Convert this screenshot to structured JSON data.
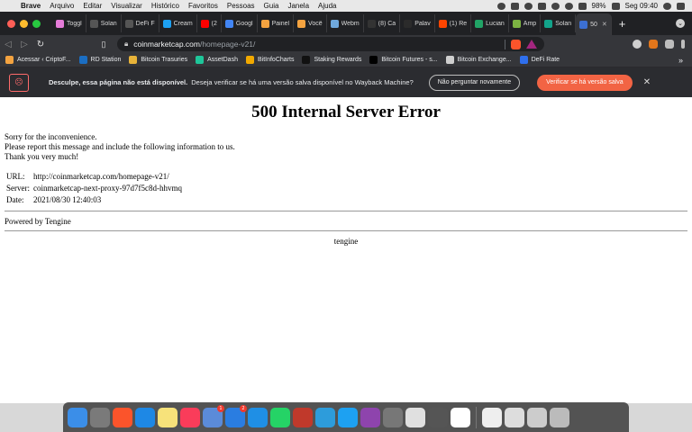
{
  "menubar": {
    "apple_glyph": "",
    "items": [
      "Brave",
      "Arquivo",
      "Editar",
      "Visualizar",
      "Histórico",
      "Favoritos",
      "Pessoas",
      "Guia",
      "Janela",
      "Ajuda"
    ],
    "battery": "98%",
    "clock": "Seg 09:40"
  },
  "tabs": [
    {
      "label": "Toggl",
      "color": "#e57cd8"
    },
    {
      "label": "Solan",
      "color": "#555555"
    },
    {
      "label": "DeFi F",
      "color": "#555555"
    },
    {
      "label": "Cream",
      "color": "#1da1f2"
    },
    {
      "label": "(2",
      "color": "#ff0000"
    },
    {
      "label": "Googl",
      "color": "#4285f4"
    },
    {
      "label": "Painel",
      "color": "#f4a340"
    },
    {
      "label": "Você",
      "color": "#f4a340"
    },
    {
      "label": "Webm",
      "color": "#6fa8dc"
    },
    {
      "label": "(8) Ca",
      "color": "#333333"
    },
    {
      "label": "Palav",
      "color": "#2b2b2b"
    },
    {
      "label": "(1) Re",
      "color": "#ff4500"
    },
    {
      "label": "Lucian",
      "color": "#21a366"
    },
    {
      "label": "Amp",
      "color": "#7cb342"
    },
    {
      "label": "Solan",
      "color": "#12a38a"
    },
    {
      "label": "50",
      "color": "#3c6fd1",
      "active": true
    }
  ],
  "toolbar": {
    "url_host": "coinmarketcap.com",
    "url_path": "/homepage-v21/"
  },
  "bookmarks": [
    {
      "label": "Acessar ‹ CriptoF...",
      "color": "#f4a340"
    },
    {
      "label": "RD Station",
      "color": "#1b6ec2"
    },
    {
      "label": "Bitcoin Trasuries",
      "color": "#e8b339"
    },
    {
      "label": "AssetDash",
      "color": "#1ec69a"
    },
    {
      "label": "BitInfoCharts",
      "color": "#f2a900"
    },
    {
      "label": "Staking Rewards",
      "color": "#111111"
    },
    {
      "label": "Bitcoin Futures - s...",
      "color": "#000000"
    },
    {
      "label": "Bitcoin Exchange...",
      "color": "#cfcfcf"
    },
    {
      "label": "DeFi Rate",
      "color": "#2f6fed"
    }
  ],
  "infobar": {
    "bold": "Desculpe, essa página não está disponível.",
    "text": "Deseja verificar se há uma versão salva disponível no Wayback Machine?",
    "dismiss_label": "Não perguntar novamente",
    "check_label": "Verificar se há versão salva"
  },
  "page": {
    "heading": "500 Internal Server Error",
    "lines": [
      "Sorry for the inconvenience.",
      "Please report this message and include the following information to us.",
      "Thank you very much!"
    ],
    "info": [
      {
        "key": "URL:",
        "value": "http://coinmarketcap.com/homepage-v21/"
      },
      {
        "key": "Server:",
        "value": "coinmarketcap-next-proxy-97d7f5c8d-hhvmq"
      },
      {
        "key": "Date:",
        "value": "2021/08/30 12:40:03"
      }
    ],
    "powered": "Powered by Tengine",
    "footer": "tengine"
  },
  "dock": [
    {
      "name": "finder",
      "color": "#3b8ee8"
    },
    {
      "name": "launchpad",
      "color": "#7a7a7a"
    },
    {
      "name": "brave",
      "color": "#fb542b"
    },
    {
      "name": "safari",
      "color": "#1e88e5"
    },
    {
      "name": "notes",
      "color": "#f7e27a"
    },
    {
      "name": "music",
      "color": "#fa3c5a"
    },
    {
      "name": "preview",
      "color": "#5b8bd9",
      "badge": "1"
    },
    {
      "name": "app-store",
      "color": "#2a7de1",
      "badge": "2"
    },
    {
      "name": "sync",
      "color": "#1f8fe5"
    },
    {
      "name": "whatsapp",
      "color": "#25d366"
    },
    {
      "name": "poker",
      "color": "#c0392b"
    },
    {
      "name": "search",
      "color": "#2d9cdb"
    },
    {
      "name": "klokki",
      "color": "#1da1f2"
    },
    {
      "name": "podcast",
      "color": "#8e44ad"
    },
    {
      "name": "vlc",
      "color": "#777777"
    },
    {
      "name": "textedit",
      "color": "#e0e0e0"
    },
    {
      "name": "calculator",
      "color": "#555555"
    },
    {
      "name": "notion",
      "color": "#ffffff"
    },
    {
      "name": "documents",
      "color": "#eeeeee"
    },
    {
      "name": "screenshot",
      "color": "#dddddd"
    },
    {
      "name": "calendar-file",
      "color": "#cccccc"
    },
    {
      "name": "trash",
      "color": "#bbbbbb"
    }
  ]
}
